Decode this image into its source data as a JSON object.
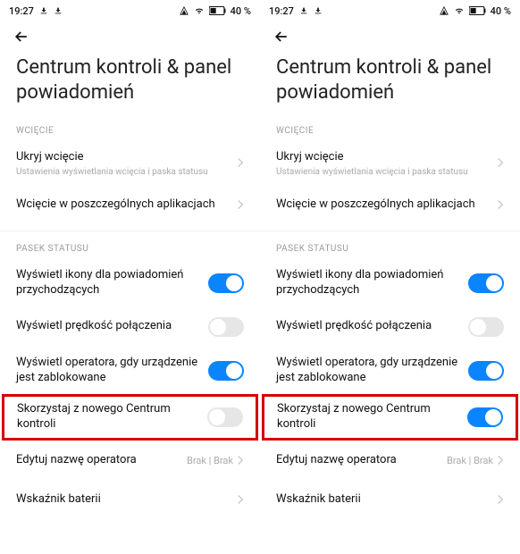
{
  "statusbar": {
    "time": "19:27",
    "battery_pct": "40 %"
  },
  "header": {
    "title": "Centrum kontroli & panel powiadomień"
  },
  "sections": {
    "notch": {
      "header": "WCIĘCIE",
      "hide_notch": {
        "label": "Ukryj wcięcie",
        "sub": "Ustawienia wyświetlania wcięcia i paska statusu"
      },
      "per_app": {
        "label": "Wcięcie w poszczególnych aplikacjach"
      }
    },
    "status": {
      "header": "PASEK STATUSU",
      "notif_icons": {
        "label": "Wyświetl ikony dla powiadomień przychodzących"
      },
      "conn_speed": {
        "label": "Wyświetl prędkość połączenia"
      },
      "operator_locked": {
        "label": "Wyświetl operatora, gdy urządzenie jest zablokowane"
      },
      "new_cc": {
        "label": "Skorzystaj z nowego Centrum kontroli"
      },
      "edit_operator": {
        "label": "Edytuj nazwę operatora",
        "value": "Brak | Brak"
      },
      "battery_ind": {
        "label": "Wskaźnik baterii"
      }
    }
  },
  "toggles": {
    "left": {
      "notif_icons": true,
      "conn_speed": false,
      "operator_locked": true,
      "new_cc": false
    },
    "right": {
      "notif_icons": true,
      "conn_speed": false,
      "operator_locked": true,
      "new_cc": true
    }
  }
}
